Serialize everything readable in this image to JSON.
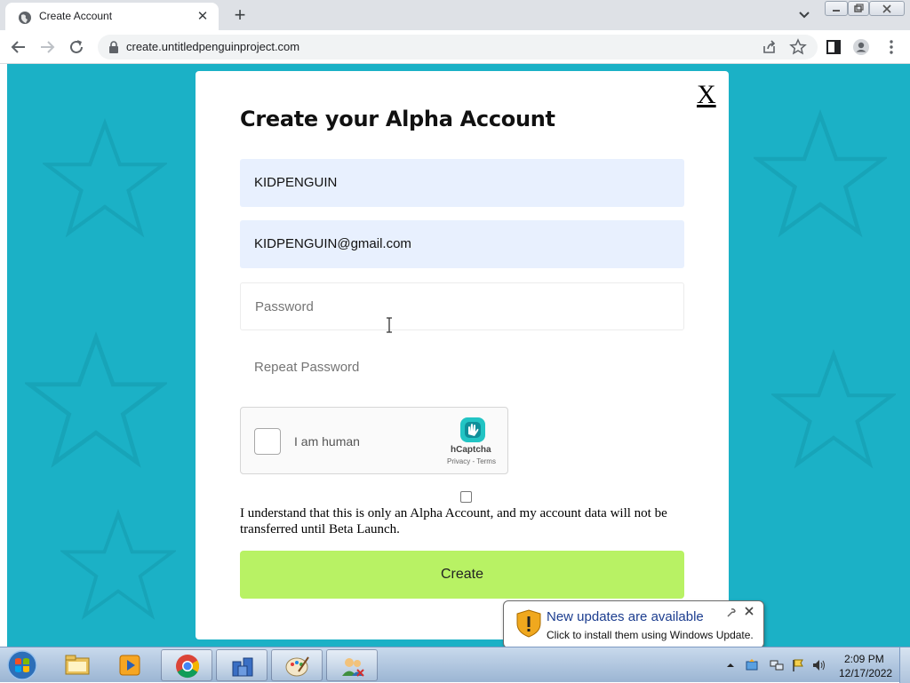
{
  "browser": {
    "tab_title": "Create Account",
    "tab_close": "✕",
    "new_tab": "+",
    "url": "create.untitledpenguinproject.com"
  },
  "modal": {
    "close_label": "X",
    "title": "Create your Alpha Account",
    "username_value": "KIDPENGUIN",
    "email_value": "KIDPENGUIN@gmail.com",
    "password_placeholder": "Password",
    "repeat_password_placeholder": "Repeat Password",
    "agree_text": "I understand that this is only an Alpha Account, and my account data will not be transferred until Beta Launch.",
    "create_label": "Create"
  },
  "captcha": {
    "label": "I am human",
    "brand": "hCaptcha",
    "links": "Privacy - Terms"
  },
  "notification": {
    "title": "New updates are available",
    "body": "Click to install them using Windows Update."
  },
  "taskbar": {
    "time": "2:09 PM",
    "date": "12/17/2022"
  },
  "colors": {
    "page_background": "#1bb1c6",
    "create_button": "#b8f264",
    "filled_field": "#e8f0fe"
  }
}
